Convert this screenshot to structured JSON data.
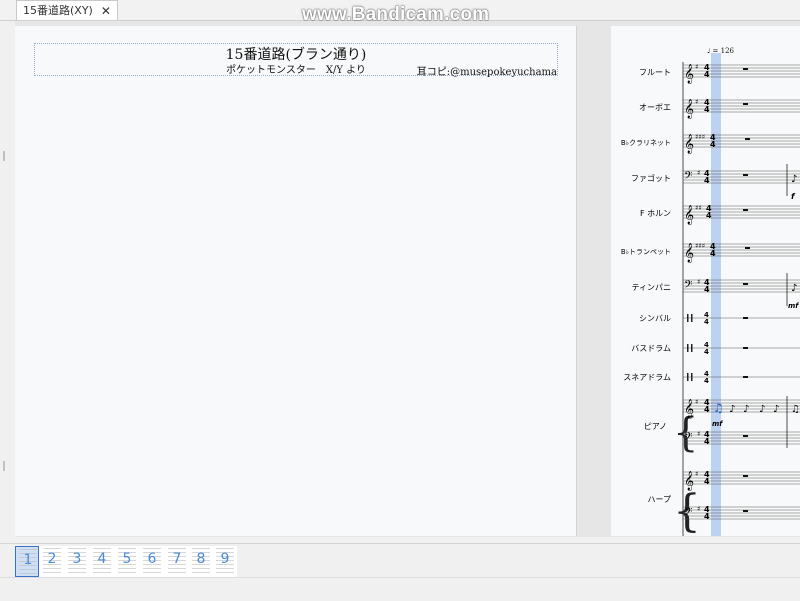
{
  "tabs": [
    {
      "label": "15番道路(XY)",
      "close": "✕"
    }
  ],
  "watermark": "www.Bandicam.com",
  "score": {
    "title": "15番道路(ブラン通り)",
    "subtitle": "ポケットモンスター　X/Y より",
    "composer": "耳コピ:@musepokeyuchama",
    "tempo": "♩ = 126",
    "instruments": [
      "フルート",
      "オーボエ",
      "B♭クラリネット",
      "ファゴット",
      "F ホルン",
      "B♭トランペット",
      "ティンパニ",
      "シンバル",
      "バスドラム",
      "スネアドラム",
      "ピアノ",
      "ハープ"
    ],
    "dynamics": {
      "fagotto": "f",
      "timpani": "mf",
      "piano": "mf"
    },
    "time_signature": "4/4"
  },
  "navigator": {
    "pages": [
      "1",
      "2",
      "3",
      "4",
      "5",
      "6",
      "7",
      "8",
      "9"
    ],
    "active_page": "1"
  },
  "colors": {
    "accent": "#4a8ad8",
    "playback_cursor": "#a9c4ec",
    "selection": "#2060c0"
  }
}
